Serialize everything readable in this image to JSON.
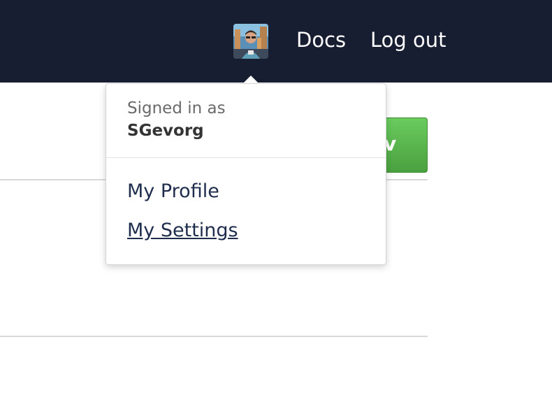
{
  "navbar": {
    "docs_label": "Docs",
    "logout_label": "Log out",
    "background_color": "#181e32"
  },
  "background_button": {
    "visible_label": "v",
    "color": "#5cb85c"
  },
  "dropdown": {
    "signed_in_label": "Signed in as",
    "username": "SGevorg",
    "items": [
      {
        "label": "My Profile"
      },
      {
        "label": "My Settings"
      }
    ]
  }
}
